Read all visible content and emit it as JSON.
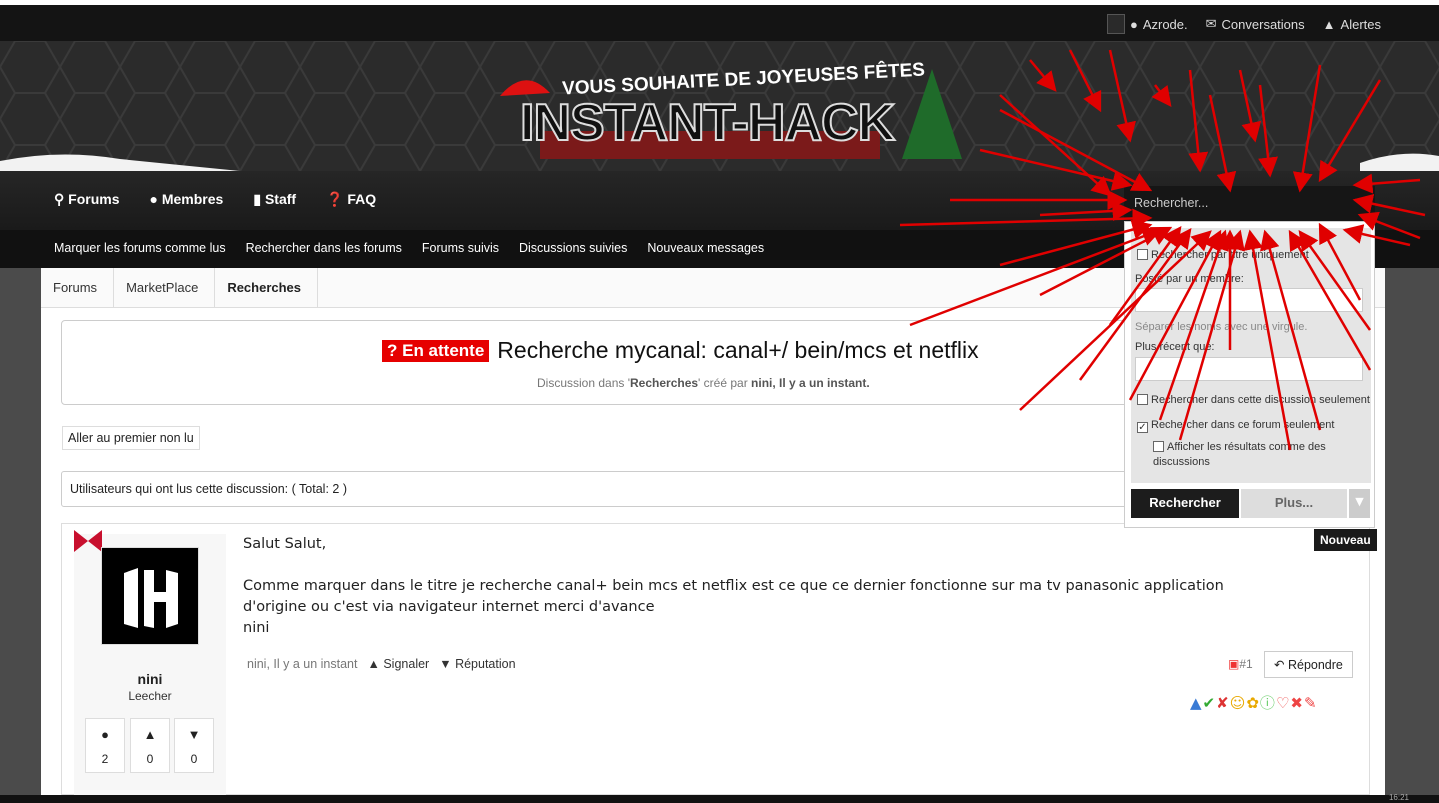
{
  "topbar": {
    "username": "Azrode.",
    "conversations": "Conversations",
    "alerts": "Alertes"
  },
  "banner": {
    "greeting": "VOUS SOUHAITE DE JOYEUSES FÊTES",
    "logo": "INSTANT-HACK"
  },
  "nav": {
    "tabs": [
      "Forums",
      "Membres",
      "Staff",
      "FAQ"
    ]
  },
  "subnav": {
    "items": [
      "Marquer les forums comme lus",
      "Rechercher dans les forums",
      "Forums suivis",
      "Discussions suivies",
      "Nouveaux messages"
    ]
  },
  "breadcrumb": [
    "Forums",
    "MarketPlace",
    "Recherches"
  ],
  "thread": {
    "badge": "? En attente",
    "title": "Recherche mycanal: canal+/ bein/mcs et netflix",
    "meta_prefix": "Discussion dans '",
    "meta_forum": "Recherches",
    "meta_mid": "' créé par ",
    "meta_author": "nini, Il y a un instant."
  },
  "first_unread": "Aller au premier non lu",
  "readers": "Utilisateurs qui ont lus cette discussion: ( Total: 2 )",
  "post": {
    "username": "nini",
    "rank": "Leecher",
    "stats": [
      "2",
      "0",
      "0"
    ],
    "greeting": "Salut Salut,",
    "body": "Comme marquer dans le titre je recherche canal+ bein mcs et netflix est ce que ce dernier fonctionne sur ma tv panasonic application d'origine ou c'est via navigateur internet merci d'avance",
    "sign": "nini",
    "date": "nini, Il y a un instant",
    "report": "Signaler",
    "reputation": "Réputation",
    "number": "#1",
    "reply": "Répondre"
  },
  "search": {
    "placeholder": "Rechercher...",
    "titles_only": "Rechercher par titre uniquement",
    "posted_by": "Posté par un membre:",
    "separate_hint": "Séparer les noms avec une virgule.",
    "newer_than": "Plus récent que:",
    "this_thread": "Rechercher dans cette discussion seulement",
    "this_forum": "Rechercher dans ce forum seulement",
    "as_threads": "Afficher les résultats comme des discussions",
    "submit": "Rechercher",
    "more": "Plus..."
  },
  "tooltip": "Nouveau",
  "clock": "16:21",
  "colors": {
    "badge": "#e60000",
    "arrow": "#e00000",
    "dark": "#161616"
  }
}
